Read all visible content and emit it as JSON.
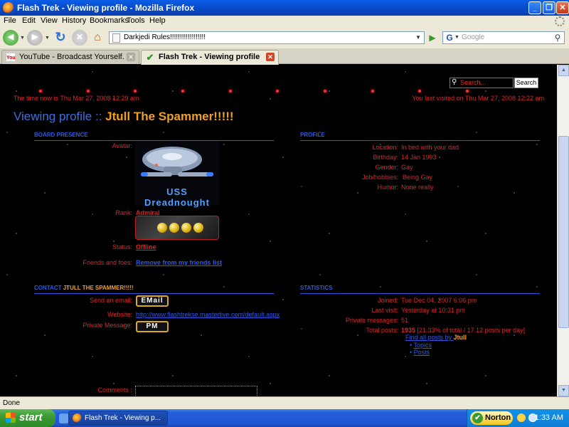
{
  "window": {
    "title": "Flash Trek - Viewing profile - Mozilla Firefox"
  },
  "menu": [
    "File",
    "Edit",
    "View",
    "History",
    "Bookmarks",
    "Tools",
    "Help"
  ],
  "nav": {
    "url": "Darkjedi Rules!!!!!!!!!!!!!!!!!!",
    "search_placeholder": "Google"
  },
  "tabs": [
    {
      "label": "YouTube - Broadcast Yourself.",
      "icon": "You Tube",
      "active": false
    },
    {
      "label": "Flash Trek - Viewing profile",
      "active": true
    }
  ],
  "page": {
    "search_placeholder": "Search...",
    "search_button": "Search",
    "time_now": "The time now is Thu Mar 27, 2008 12:29 am",
    "last_visit": "You last visited on Thu Mar 27, 2008 12:22 am",
    "title_prefix": "Viewing profile :: ",
    "username": "Jtull The Spammer!!!!!",
    "board_presence": {
      "header": "BOARD PRESENCE",
      "avatar_label": "Avatar:",
      "avatar_text": "USS Dreadnought",
      "rank_label": "Rank:",
      "rank": "Admiral",
      "status_label": "Status:",
      "status": "Offline",
      "friends_label": "Friends and foes:",
      "friends_link": "Remove from my friends list"
    },
    "profile": {
      "header": "PROFILE",
      "rows": [
        {
          "label": "Location:",
          "value": "In bed with your dad"
        },
        {
          "label": "Birthday:",
          "value": "14 Jan 1993"
        },
        {
          "label": "Gender:",
          "value": "Gay"
        },
        {
          "label": "Job/hobbies:",
          "value": "Being Gay"
        },
        {
          "label": "Humor:",
          "value": "None really"
        }
      ]
    },
    "contact": {
      "header_prefix": "CONTACT ",
      "header_name": "JTULL THE SPAMMER!!!!!",
      "email_label": "Send an email:",
      "email_button": "EMail",
      "website_label": "Website:",
      "website": "http://www.flashtrekse.mastertive.com/default.aspx",
      "pm_label": "Private Message:",
      "pm_button": "PM",
      "comments_label": "Comments :"
    },
    "statistics": {
      "header": "STATISTICS",
      "joined_label": "Joined:",
      "joined": "Tue Dec 04, 2007 6:06 pm",
      "lastvisit_label": "Last visit:",
      "lastvisit": "Yesterday at 10:31 pm",
      "pm_label": "Private messages:",
      "pm_count": "51",
      "posts_label": "Total posts:",
      "posts_count": "1935",
      "posts_detail": " [21.33% of total / 17.12 posts per day]",
      "find_posts_prefix": "Find all posts by ",
      "find_posts_name": "Jtull",
      "topics_link": "Topics",
      "posts_link": "Posts"
    }
  },
  "status": {
    "text": "Done"
  },
  "taskbar": {
    "start": "start",
    "window_item": "Flash Trek - Viewing p...",
    "norton": "Norton",
    "clock": "1:33 AM"
  },
  "colors": {
    "title_blue": "#3c6fe0",
    "username_orange": "#f0a020",
    "body_red": "#d42a2a",
    "section_blue": "#2f58e0"
  }
}
